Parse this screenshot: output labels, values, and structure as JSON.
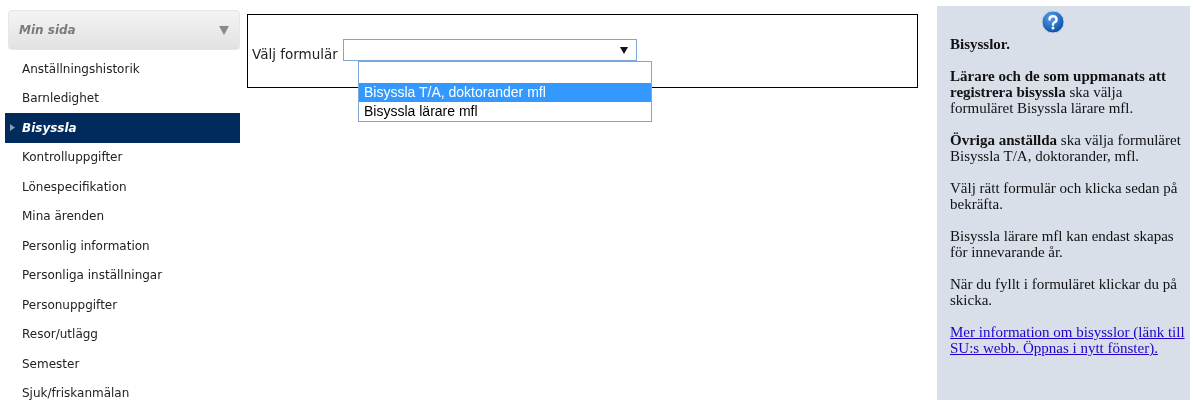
{
  "sidebar": {
    "header": "Min sida",
    "items": [
      {
        "label": "Anställningshistorik",
        "selected": false
      },
      {
        "label": "Barnledighet",
        "selected": false
      },
      {
        "label": "Bisyssla",
        "selected": true
      },
      {
        "label": "Kontrolluppgifter",
        "selected": false
      },
      {
        "label": "Lönespecifikation",
        "selected": false
      },
      {
        "label": "Mina ärenden",
        "selected": false
      },
      {
        "label": "Personlig information",
        "selected": false
      },
      {
        "label": "Personliga inställningar",
        "selected": false
      },
      {
        "label": "Personuppgifter",
        "selected": false
      },
      {
        "label": "Resor/utlägg",
        "selected": false
      },
      {
        "label": "Semester",
        "selected": false
      },
      {
        "label": "Sjuk/friskanmälan",
        "selected": false
      }
    ]
  },
  "form": {
    "label": "Välj formulär",
    "dropdown": {
      "expanded": true,
      "options": [
        {
          "label": "Bisyssla T/A, doktorander mfl",
          "selected": true
        },
        {
          "label": "Bisyssla lärare mfl",
          "selected": false
        }
      ]
    }
  },
  "help": {
    "title": "Bisysslor.",
    "paragraphs": [
      "**Lärare och de som uppmanats att registrera bisyssla** ska välja formuläret Bisyssla lärare mfl.",
      "**Övriga anställda** ska välja formuläret Bisyssla T/A, doktorander, mfl.",
      "Välj rätt formulär och klicka sedan på bekräfta.",
      "Bisyssla lärare mfl kan endast skapas för innevarande år.",
      "När du fyllt i formuläret klickar du på skicka."
    ],
    "link": "Mer information om bisysslor (länk till SU:s webb. Öppnas i nytt fönster)."
  }
}
